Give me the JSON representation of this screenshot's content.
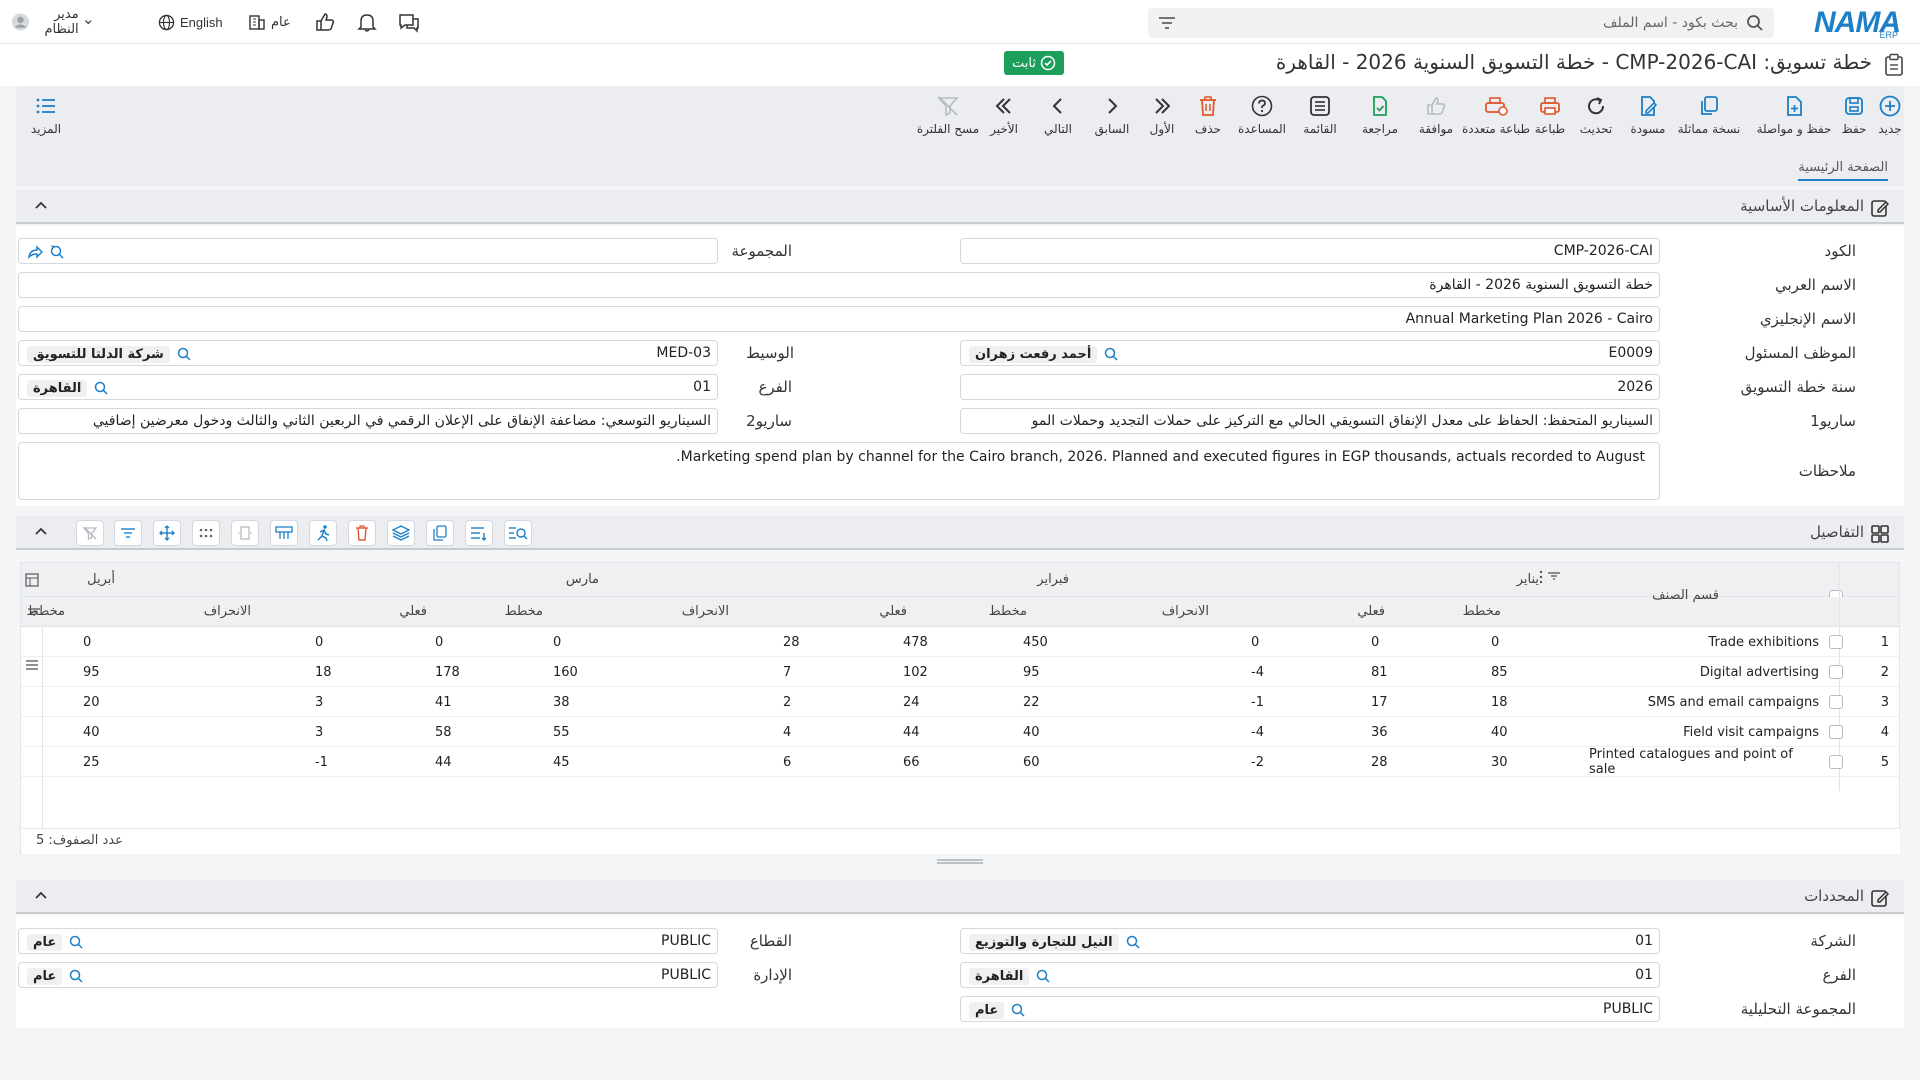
{
  "app": {
    "logo_text": "NAMA",
    "logo_sub": "ERP",
    "search_placeholder": "بحث بكود - اسم الملف",
    "user_name": "مدير النظام",
    "language": "English",
    "scope": "عام"
  },
  "title": {
    "text": "خطة تسويق: CMP-2026-CAI - خطة التسويق السنوية 2026 - القاهرة",
    "status": "ثابت"
  },
  "toolbar": {
    "new": "جديد",
    "save": "حفظ",
    "save_continue": "حفظ و مواصلة",
    "copy": "نسخة مماثلة",
    "draft": "مسودة",
    "refresh": "تحديث",
    "print": "طباعة",
    "multi_print": "طباعة متعددة",
    "approve": "موافقة",
    "review": "مراجعة",
    "list": "القائمة",
    "help": "المساعدة",
    "delete": "حذف",
    "first": "الأول",
    "prev": "السابق",
    "next": "التالي",
    "last": "الأخير",
    "clear_filter": "مسح الفلترة",
    "more": "المزيد"
  },
  "tabs": {
    "main": "الصفحة الرئيسية"
  },
  "basic_info": {
    "title": "المعلومات الأساسية",
    "code_label": "الكود",
    "code": "CMP-2026-CAI",
    "group_label": "المجموعة",
    "arabic_name_label": "الاسم العربي",
    "arabic_name": "خطة التسويق السنوية 2026 - القاهرة",
    "english_name_label": "الاسم الإنجليزي",
    "english_name": "Annual Marketing Plan 2026 - Cairo",
    "employee_label": "الموظف المسئول",
    "employee_code": "E0009",
    "employee_name": "أحمد رفعت زهران",
    "broker_label": "الوسيط",
    "broker_code": "MED-03",
    "broker_name": "شركة الدلتا للتسويق",
    "year_label": "سنة خطة التسويق",
    "year": "2026",
    "branch_label": "الفرع",
    "branch_code": "01",
    "branch_name": "القاهرة",
    "scenario1_label": "ساريو1",
    "scenario1": "السيناريو المتحفظ: الحفاظ على معدل الإنفاق التسويقي الحالي مع التركيز على حملات التجديد وحملات المو",
    "scenario2_label": "ساريو2",
    "scenario2": "السيناريو التوسعي: مضاعفة الإنفاق على الإعلان الرقمي في الربعين الثاني والثالث ودخول معرضين إضافيي",
    "notes_label": "ملاحظات",
    "notes": "Marketing spend plan by channel for the Cairo branch, 2026. Planned and executed figures in EGP thousands, actuals recorded to August."
  },
  "details": {
    "title": "التفاصيل",
    "col_category": "قسم الصنف",
    "months": [
      "يناير",
      "فبراير",
      "مارس",
      "أبريل"
    ],
    "sub_planned": "مخطط",
    "sub_actual": "فعلي",
    "sub_variance": "الانحراف",
    "rows": [
      {
        "n": "1",
        "category": "Trade exhibitions",
        "jan": [
          "0",
          "0",
          "0"
        ],
        "feb": [
          "450",
          "478",
          "28"
        ],
        "mar": [
          "0",
          "0",
          "0"
        ],
        "apr": "0"
      },
      {
        "n": "2",
        "category": "Digital advertising",
        "jan": [
          "85",
          "81",
          "-4"
        ],
        "feb": [
          "95",
          "102",
          "7"
        ],
        "mar": [
          "160",
          "178",
          "18"
        ],
        "apr": "95"
      },
      {
        "n": "3",
        "category": "SMS and email campaigns",
        "jan": [
          "18",
          "17",
          "-1"
        ],
        "feb": [
          "22",
          "24",
          "2"
        ],
        "mar": [
          "38",
          "41",
          "3"
        ],
        "apr": "20"
      },
      {
        "n": "4",
        "category": "Field visit campaigns",
        "jan": [
          "40",
          "36",
          "-4"
        ],
        "feb": [
          "40",
          "44",
          "4"
        ],
        "mar": [
          "55",
          "58",
          "3"
        ],
        "apr": "40"
      },
      {
        "n": "5",
        "category": "Printed catalogues and point of sale",
        "jan": [
          "30",
          "28",
          "-2"
        ],
        "feb": [
          "60",
          "66",
          "6"
        ],
        "mar": [
          "45",
          "44",
          "-1"
        ],
        "apr": "25"
      }
    ],
    "row_count_label": "عدد الصفوف: 5"
  },
  "dimensions": {
    "title": "المحددات",
    "company_label": "الشركة",
    "company_code": "01",
    "company_name": "النيل للتجارة والتوزيع",
    "sector_label": "القطاع",
    "sector_code": "PUBLIC",
    "sector_name": "عام",
    "branch_label": "الفرع",
    "branch_code": "01",
    "branch_name": "القاهرة",
    "dept_label": "الإدارة",
    "dept_code": "PUBLIC",
    "dept_name": "عام",
    "analytic_label": "المجموعة التحليلية",
    "analytic_code": "PUBLIC",
    "analytic_name": "عام"
  }
}
